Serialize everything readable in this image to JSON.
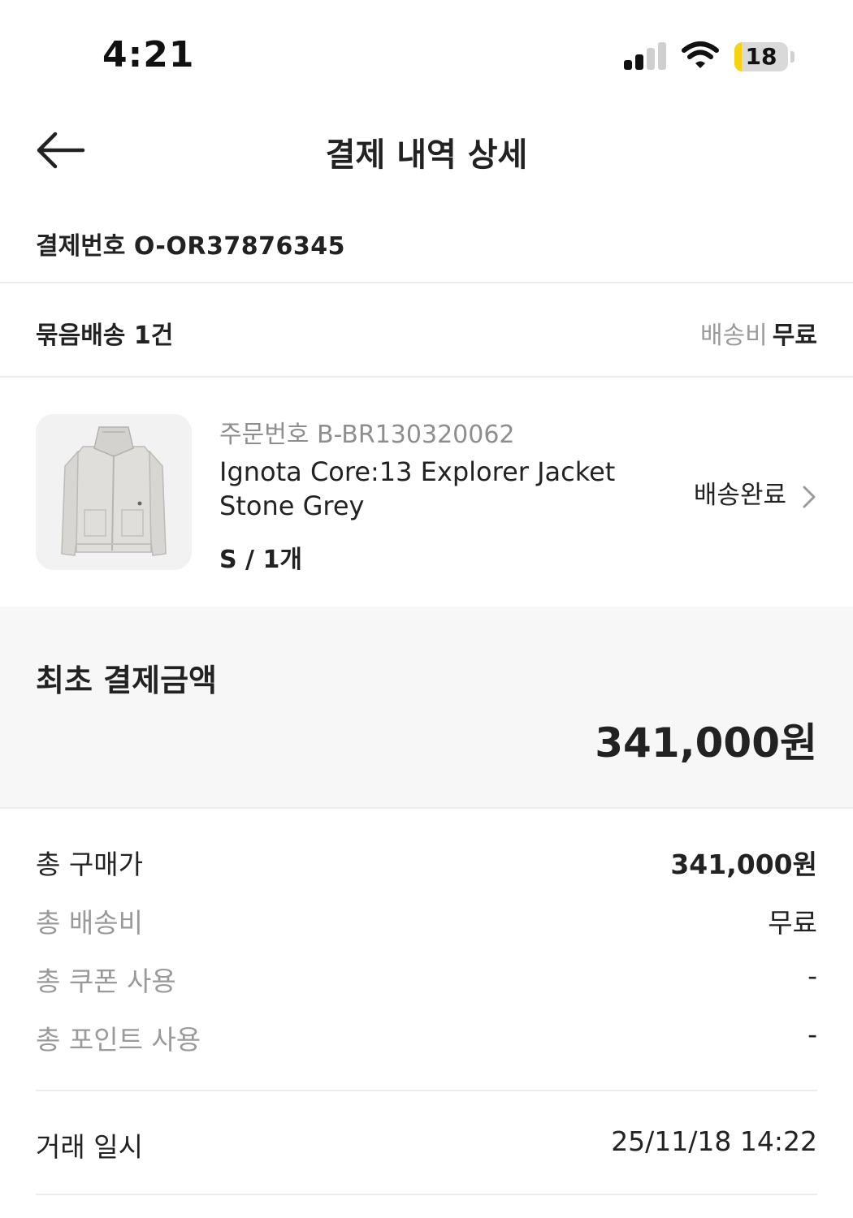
{
  "status_bar": {
    "time": "4:21",
    "battery_level": "18",
    "battery_color": "#f7d20f",
    "icons": [
      "signal-icon",
      "wifi-icon",
      "battery-icon"
    ]
  },
  "header": {
    "title": "결제 내역 상세",
    "back_icon": "arrow-left-icon"
  },
  "payment": {
    "number_label": "결제번호",
    "number": "O-OR37876345"
  },
  "bundle": {
    "label": "묶음배송 1건",
    "shipping_fee_label": "배송비",
    "shipping_fee_value": "무료"
  },
  "product": {
    "order_number_label": "주문번호",
    "order_number": "B-BR130320062",
    "name": "Ignota Core:13 Explorer Jacket Stone Grey",
    "option": "S / 1개",
    "status": "배송완료",
    "status_icon": "chevron-right-icon"
  },
  "initial_payment": {
    "label": "최초 결제금액",
    "amount": "341,000원"
  },
  "summary": {
    "rows": [
      {
        "label": "총 구매가",
        "value": "341,000원"
      },
      {
        "label": "총 배송비",
        "value": "무료"
      },
      {
        "label": "총 쿠폰 사용",
        "value": "-"
      },
      {
        "label": "총 포인트 사용",
        "value": "-"
      }
    ]
  },
  "transaction": {
    "label": "거래 일시",
    "value": "25/11/18 14:22"
  }
}
